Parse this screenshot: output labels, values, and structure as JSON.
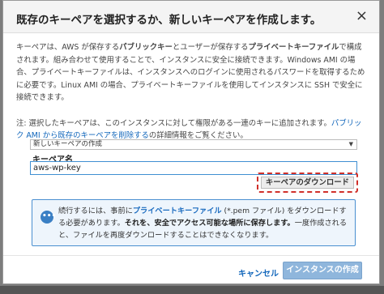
{
  "dialog": {
    "title": "既存のキーペアを選択するか、新しいキーペアを作成します。",
    "close_symbol": "×"
  },
  "description": {
    "line1": "キーペアは、AWS が保存する",
    "line1_bold1": "パブリックキー",
    "line1_mid": "とユーザーが保存する",
    "line1_bold2": "プライベートキーファイル",
    "line1_end": "で構成されます。組み合わせて使用することで、インスタンスに安全に接続できます。Windows AMI の場合、プライベートキーファイルは、インスタンスへのログインに使用されるパスワードを取得するために必要です。Linux AMI の場合、プライベートキーファイルを使用してインスタンスに SSH で安全に接続できます。"
  },
  "note": {
    "prefix": "注: 選択したキーペアは、このインスタンスに対して権限がある一連のキーに追加されます。",
    "link": "パブリック AMI から既存のキーペアを削除する",
    "suffix": "の詳細情報をご覧ください。"
  },
  "key_pair": {
    "select_value": "新しいキーペアの作成",
    "name_label": "キーペア名",
    "name_value": "aws-wp-key",
    "download_label": "キーペアのダウンロード"
  },
  "info": {
    "icon_text": "•••",
    "t1": "続行するには、事前に",
    "t1_blue": "プライベートキーファイル",
    "t1_end": " (*.pem ファイル) をダウンロードする必要があります。",
    "t2_bold": "それを、安全でアクセス可能な場所に保存します。",
    "t3": "一度作成されると、ファイルを再度ダウンロードすることはできなくなります。"
  },
  "footer": {
    "cancel_label": "キャンセル",
    "launch_label": "インスタンスの作成"
  },
  "colors": {
    "accent": "#1166bb",
    "download_highlight": "#d0302a",
    "info_border": "#4a8fd0",
    "launch_button": "#8fb6dc"
  }
}
